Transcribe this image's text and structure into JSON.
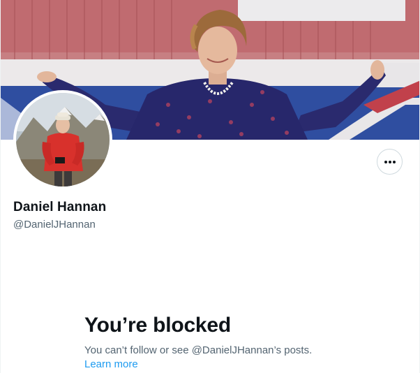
{
  "profile": {
    "banner_image": "banner-photo-woman-waving-union-flag",
    "avatar_image": "avatar-photo-man-red-jacket-mountains",
    "display_name": "Daniel Hannan",
    "handle": "@DanielJHannan"
  },
  "actions": {
    "more_icon": "more-horizontal-icon"
  },
  "blocked": {
    "title": "You’re blocked",
    "message": "You can’t follow or see @DanielJHannan’s posts.",
    "learn_more": "Learn more"
  },
  "colors": {
    "text_primary": "#0f1419",
    "text_secondary": "#536471",
    "link": "#1d9bf0",
    "border": "#cfd9de"
  }
}
